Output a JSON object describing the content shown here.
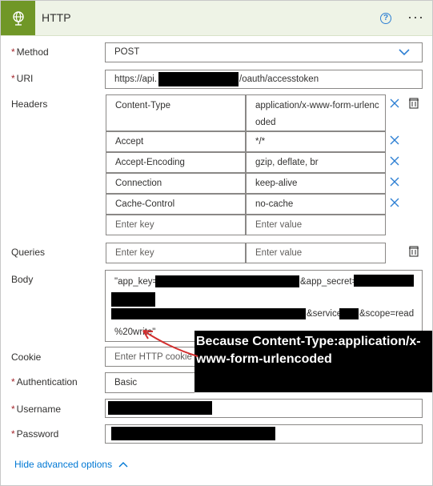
{
  "header": {
    "title": "HTTP",
    "help_icon": "?",
    "more_icon": "···"
  },
  "method": {
    "label": "Method",
    "value": "POST"
  },
  "uri": {
    "label": "URI",
    "prefix": "https://api.",
    "suffix": "/oauth/accesstoken"
  },
  "headers": {
    "label": "Headers",
    "rows": [
      {
        "key": "Content-Type",
        "value": "application/x-www-form-urlenc",
        "value_cont": "oded"
      },
      {
        "key": "Accept",
        "value": "*/*"
      },
      {
        "key": "Accept-Encoding",
        "value": "gzip, deflate, br"
      },
      {
        "key": "Connection",
        "value": "keep-alive"
      },
      {
        "key": "Cache-Control",
        "value": "no-cache"
      }
    ],
    "key_placeholder": "Enter key",
    "value_placeholder": "Enter value"
  },
  "queries": {
    "label": "Queries",
    "key_placeholder": "Enter key",
    "value_placeholder": "Enter value"
  },
  "body": {
    "label": "Body",
    "line1_a": "\"app_key=",
    "line1_b": "&app_secret=",
    "line3_b": "&service=",
    "line3_c": "&scope=read",
    "line4": "%20write\""
  },
  "cookie": {
    "label": "Cookie",
    "placeholder": "Enter HTTP cookie"
  },
  "authentication": {
    "label": "Authentication",
    "value": "Basic"
  },
  "username": {
    "label": "Username"
  },
  "password": {
    "label": "Password"
  },
  "annotation": {
    "text": "Because Content-Type:application/x-www-form-urlencoded"
  },
  "advanced": {
    "label": "Hide advanced options"
  },
  "colors": {
    "accent": "#709727",
    "link": "#0078d4",
    "required": "#a4262c",
    "annotation_arrow": "#d32f2f"
  }
}
